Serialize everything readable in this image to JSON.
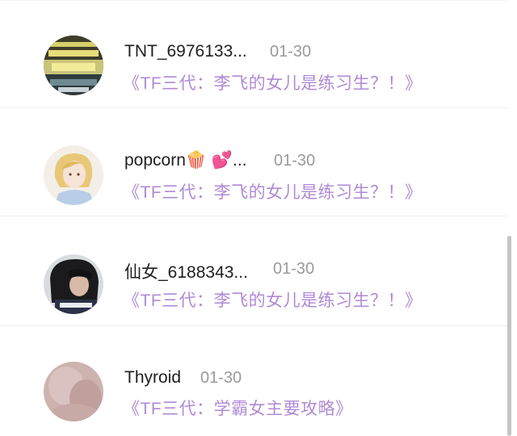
{
  "comments": [
    {
      "name": "TNT_6976133...",
      "date": "01-30",
      "link": "《TF三代：李飞的女儿是练习生？！》",
      "avatar": "stadium-photo-avatar"
    },
    {
      "name": "popcorn🍿 💕...",
      "date": "01-30",
      "link": "《TF三代：李飞的女儿是练习生？！》",
      "avatar": "anime-girl-avatar"
    },
    {
      "name": "仙女_6188343...",
      "date": "01-30",
      "link": "《TF三代：李飞的女儿是练习生？！》",
      "avatar": "dark-hair-girl-avatar"
    },
    {
      "name": "Thyroid",
      "date": "01-30",
      "link": "《TF三代：学霸女主要攻略》",
      "avatar": "pink-blur-avatar"
    }
  ],
  "colors": {
    "link": "#b08ad6",
    "name": "#1f1f1f",
    "date": "#9a9a9a"
  }
}
